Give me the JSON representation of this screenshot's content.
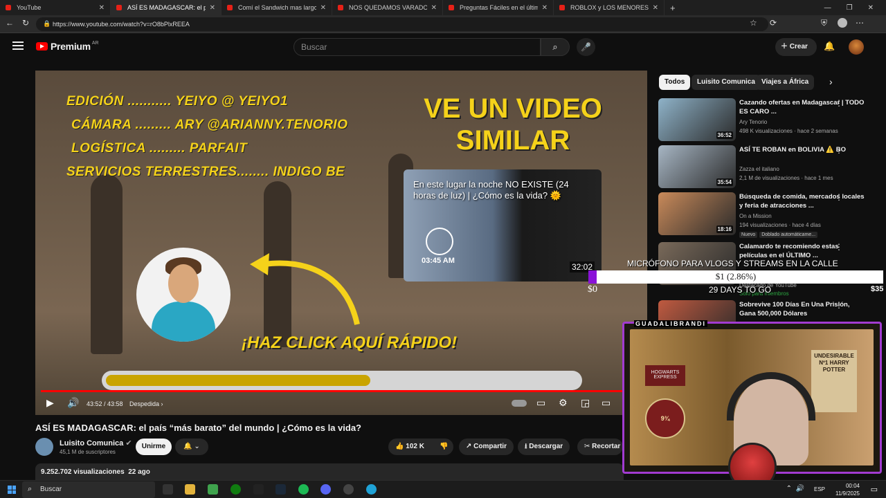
{
  "browser": {
    "tabs": [
      {
        "title": "YouTube",
        "active": false
      },
      {
        "title": "ASÍ ES MADAGASCAR: el país “más barato”",
        "active": true
      },
      {
        "title": "Comí el Sandwich mas largo del mundo",
        "active": false
      },
      {
        "title": "NOS QUEDAMOS VARADOS EN LA ISLA",
        "active": false
      },
      {
        "title": "Preguntas Fáciles en el último pa",
        "active": false
      },
      {
        "title": "ROBLOX y LOS MENORES en PELIGRO",
        "active": false
      }
    ],
    "url": "https://www.youtube.com/watch?v=rO8bPlxREEA"
  },
  "header": {
    "logo": "Premium",
    "region": "AR",
    "search_placeholder": "Buscar",
    "create_label": "Crear"
  },
  "player": {
    "credits": [
      "EDICIÓN ........... YEIYO @ YEIYO1",
      "CÁMARA ......... ARY @ARIANNY.TENORIO",
      "LOGÍSTICA ......... PARFAIT",
      "SERVICIOS TERRESTRES........ INDIGO BE"
    ],
    "endscreen_promo": "VE UN VIDEO SIMILAR",
    "endcard_title": "En este lugar la noche NO EXISTE (24 horas de luz) | ¿Cómo es la vida? 🌞",
    "endcard_time": "03:45 AM",
    "endcard_duration": "32:02",
    "click_text": "¡HAZ CLICK AQUÍ RÁPIDO!",
    "progress_fraction": 0.56,
    "scrub_fraction": 0.998,
    "time": "43:52 / 43:58",
    "chapter": "Despedida"
  },
  "video": {
    "title": "ASÍ ES MADAGASCAR: el país “más barato” del mundo | ¿Cómo es la vida?",
    "channel": "Luisito Comunica",
    "subscribers": "45,1 M de suscriptores",
    "join_label": "Unirme",
    "likes": "102 K",
    "share_label": "Compartir",
    "download_label": "Descargar",
    "clip_label": "Recortar",
    "views": "9.252.702 visualizaciones",
    "age": "22 ago"
  },
  "sidebar": {
    "chips": [
      "Todos",
      "Luisito Comunica",
      "Viajes a África"
    ],
    "recommendations": [
      {
        "title": "Cazando ofertas en Madagascar | TODO ES CARO ...",
        "channel": "Ary Tenorio",
        "meta": "498 K visualizaciones · hace 2 semanas",
        "duration": "36:52",
        "color": "#8fb3c9"
      },
      {
        "title": "ASÍ TE ROBAN en BOLIVIA ⚠️ BO",
        "channel": "Zazza el italiano",
        "meta": "2,1 M de visualizaciones · hace 1 mes",
        "duration": "35:54",
        "color": "#a7b6c4"
      },
      {
        "title": "Búsqueda de comida, mercados locales y feria de atracciones ...",
        "channel": "On a Mission",
        "meta": "194 visualizaciones · hace 4 días",
        "duration": "18:16",
        "color": "#c98a5a",
        "badges": [
          "Nuevo",
          "Doblado automáticame..."
        ]
      },
      {
        "title": "Calamardo te recomiendo estas películas en el ÚLTIMO ...",
        "channel": "Destacado de YouTube",
        "meta": "Solo para miembros",
        "duration": "",
        "color": "#7a6a5a"
      },
      {
        "title": "Sobrevive 100 Días En Una Prisión, Gana 500,000 Dólares",
        "channel": "",
        "meta": "",
        "duration": "",
        "color": "#c05a40"
      }
    ]
  },
  "overlay": {
    "goal_title": "MICRÓFONO PARA VLOGS Y STREAMS EN LA CALLE",
    "goal_value": "$1 (2.86%)",
    "goal_fraction": 0.0286,
    "goal_start": "$0",
    "goal_end": "$35",
    "goal_days": "29 DAYS TO GO",
    "streamer": "GUADALIBRANDI",
    "poster_text": "UNDESIRABLE Nº1 HARRY POTTER",
    "platform_text": "9¾",
    "hogwarts_text": "HOGWARTS EXPRESS"
  },
  "taskbar": {
    "search": "Buscar",
    "lang": "ESP",
    "time": "00:04",
    "date": "11/9/2025"
  }
}
